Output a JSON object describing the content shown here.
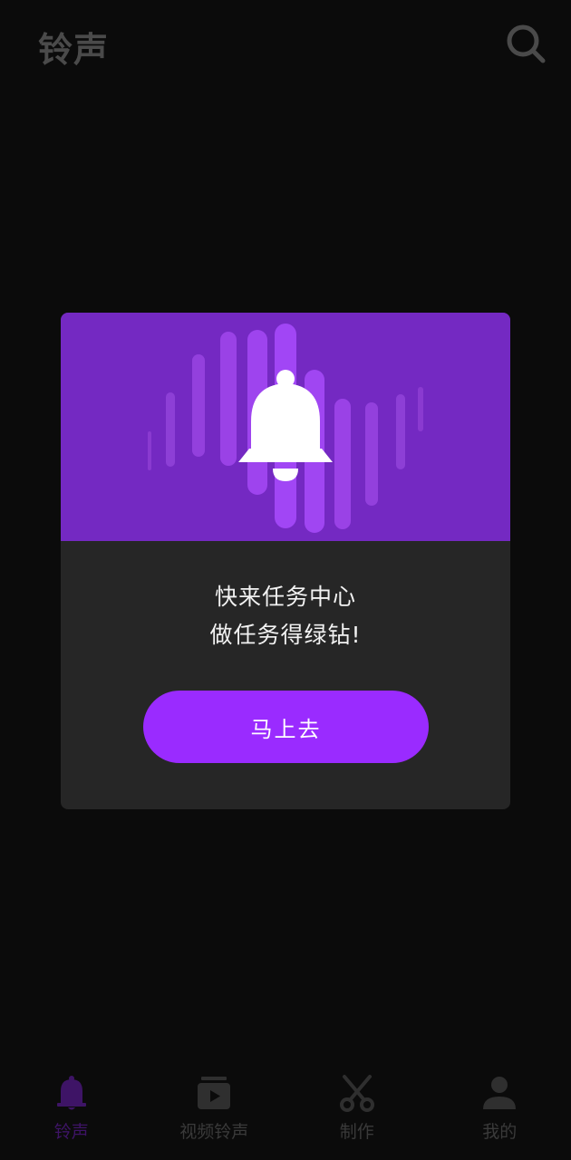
{
  "app": {
    "title": "铃声"
  },
  "icons": {
    "search": "search-icon",
    "bell": "bell-icon",
    "video": "video-play-icon",
    "scissors": "scissors-icon",
    "user": "user-icon"
  },
  "dialog": {
    "line1": "快来任务中心",
    "line2": "做任务得绿钻!",
    "button_label": "马上去",
    "colors": {
      "hero": "#7429c2",
      "button": "#9a2bff",
      "body": "#262626"
    }
  },
  "nav": {
    "items": [
      {
        "label": "铃声",
        "icon": "bell-icon",
        "active": true
      },
      {
        "label": "视频铃声",
        "icon": "video-play-icon",
        "active": false
      },
      {
        "label": "制作",
        "icon": "scissors-icon",
        "active": false
      },
      {
        "label": "我的",
        "icon": "user-icon",
        "active": false
      }
    ],
    "active_color": "#3e1466",
    "inactive_color": "#3a3a3a"
  }
}
